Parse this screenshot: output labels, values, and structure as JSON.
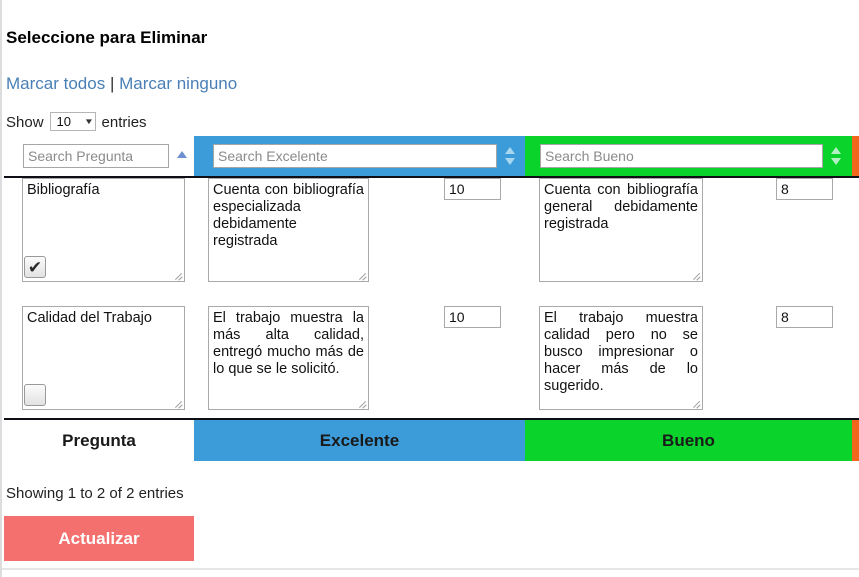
{
  "page": {
    "title": "Seleccione para Eliminar",
    "info_text": "Showing 1 to 2 of 2 entries"
  },
  "mark_links": {
    "all_label": "Marcar todos",
    "separator": "|",
    "none_label": "Marcar ninguno"
  },
  "length_menu": {
    "prefix": "Show",
    "value": "10",
    "suffix": "entries",
    "caret": "▼"
  },
  "columns": [
    {
      "key": "pregunta",
      "label": "Pregunta",
      "search_placeholder": "Search Pregunta",
      "sort": "asc",
      "color": "#ffffff"
    },
    {
      "key": "excelente",
      "label": "Excelente",
      "search_placeholder": "Search Excelente",
      "sort": "both",
      "color": "#3c9bd9"
    },
    {
      "key": "bueno",
      "label": "Bueno",
      "search_placeholder": "Search Bueno",
      "sort": "both",
      "color": "#0ad42b"
    },
    {
      "key": "extra",
      "label": "",
      "search_placeholder": "",
      "sort": "none",
      "color": "#f4671a"
    }
  ],
  "rows": [
    {
      "pregunta": "Bibliografía",
      "selected": true,
      "check_glyph": "✔",
      "excelente_text": "Cuenta con bibliografía especializada debidamente registrada",
      "excelente_value": "10",
      "bueno_text": "Cuenta con bibliografía general debidamente registrada",
      "bueno_value": "8"
    },
    {
      "pregunta": "Calidad del Trabajo",
      "selected": false,
      "check_glyph": "",
      "excelente_text": "El trabajo muestra la más alta calidad, entregó mucho más de lo que se le solicitó.",
      "excelente_value": "10",
      "bueno_text": "El trabajo muestra calidad pero no se busco impresionar o hacer más de lo sugerido.",
      "bueno_value": "8"
    }
  ],
  "update_button": {
    "label": "Actualizar",
    "color": "#f4706e"
  }
}
